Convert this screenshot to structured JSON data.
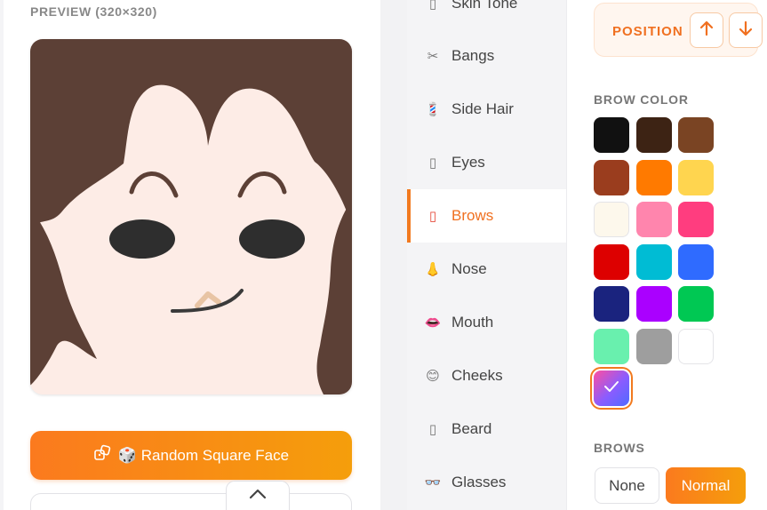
{
  "preview": {
    "title": "PREVIEW (320×320)",
    "face": {
      "skin_color": "#fdece6",
      "hair_color": "#5c4036",
      "eye_color": "#2e2e2e",
      "brow_color": "#5c4036",
      "nose_color": "#e8c4a4",
      "mouth_color": "#3a3a3a"
    }
  },
  "actions": {
    "random_label": "🎲 Random Square Face",
    "random_icon": "dice-icon",
    "collapse_icon": "chevron-up-icon"
  },
  "categories": [
    {
      "label": "Skin Tone",
      "icon": "skin-icon",
      "glyph": "▯",
      "active": false
    },
    {
      "label": "Bangs",
      "icon": "scissors-icon",
      "glyph": "✂",
      "active": false
    },
    {
      "label": "Side Hair",
      "icon": "comb-icon",
      "glyph": "💈",
      "active": false
    },
    {
      "label": "Eyes",
      "icon": "eye-icon",
      "glyph": "▯",
      "active": false
    },
    {
      "label": "Brows",
      "icon": "brow-icon",
      "glyph": "▯",
      "active": true
    },
    {
      "label": "Nose",
      "icon": "nose-icon",
      "glyph": "👃",
      "active": false
    },
    {
      "label": "Mouth",
      "icon": "lips-icon",
      "glyph": "👄",
      "active": false
    },
    {
      "label": "Cheeks",
      "icon": "smile-icon",
      "glyph": "😊",
      "active": false
    },
    {
      "label": "Beard",
      "icon": "beard-icon",
      "glyph": "▯",
      "active": false
    },
    {
      "label": "Glasses",
      "icon": "glasses-icon",
      "glyph": "👓",
      "active": false
    }
  ],
  "options": {
    "position_label": "POSITION",
    "up_icon": "arrow-up-icon",
    "down_icon": "arrow-down-icon",
    "brow_color_title": "BROW COLOR",
    "colors": [
      "#111111",
      "#3d2314",
      "#7a4423",
      "#9a3d1e",
      "#ff7a00",
      "#ffd54f",
      "#fdf8ec",
      "#ff85ad",
      "#ff3d7f",
      "#dd0000",
      "#00bcd4",
      "#2f6bff",
      "#1a237e",
      "#aa00ff",
      "#00c853",
      "#69f0ae",
      "#9e9e9e",
      "#ffffff",
      "gradient-purple"
    ],
    "selected_color_index": 18,
    "selected_icon": "check-icon",
    "brows_title": "BROWS",
    "brows_options": [
      "None",
      "Normal"
    ],
    "brows_selected": "Normal"
  }
}
